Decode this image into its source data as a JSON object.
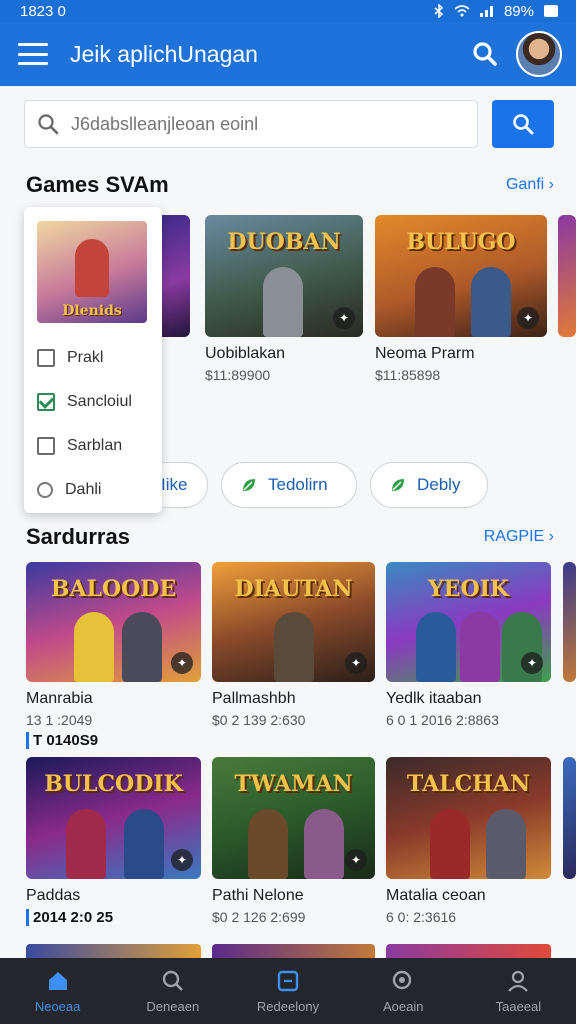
{
  "status_bar": {
    "time": "1823 0",
    "battery": "89%"
  },
  "app_bar": {
    "title": "Jeik aplichUnagan"
  },
  "search": {
    "placeholder": "J6dabslleanjleoan eoinl"
  },
  "section1": {
    "title": "Games SVAm",
    "see_all": "Ganfi",
    "arrow": "›",
    "cards": [
      {
        "tag": "DUOBAN",
        "title": "Uobiblakan",
        "sub": "$11:89900"
      },
      {
        "tag": "BULUGO",
        "title": "Neoma Prarm",
        "sub": "$11:85898"
      }
    ]
  },
  "dropdown": {
    "image_tag": "Dlenids",
    "items": [
      {
        "label": "Prakl",
        "checked": false
      },
      {
        "label": "Sancloiul",
        "checked": true
      },
      {
        "label": "Sarblan",
        "checked": false
      },
      {
        "label": "Dahli"
      }
    ]
  },
  "chips": [
    {
      "label": "Iike"
    },
    {
      "label": "Tedolirn"
    },
    {
      "label": "Debly"
    }
  ],
  "section2": {
    "title": "Sardurras",
    "see_all": "RAGPIE",
    "arrow": "›",
    "cards": [
      {
        "tag": "BALOODE",
        "title": "Manrabia",
        "sub": "13 1 :2049",
        "date": "T 0140S9"
      },
      {
        "tag": "DIAUTAN",
        "title": "Pallmashbh",
        "sub": "$0 2 139 2:630",
        "date": ""
      },
      {
        "tag": "YEOIK",
        "title": "Yedlk itaaban",
        "sub": "6 0 1 2016 2:8863",
        "date": ""
      },
      {
        "tag": "BULCODIK",
        "title": "Paddas",
        "sub": "",
        "date": "2014 2:0 25"
      },
      {
        "tag": "TWAMAN",
        "title": "Pathi Nelone",
        "sub": "$0 2 126 2:699",
        "date": ""
      },
      {
        "tag": "TALCHAN",
        "title": "Matalia ceoan",
        "sub": "6 0: 2:3616",
        "date": ""
      }
    ]
  },
  "bottom_nav": [
    {
      "label": "Neoeaa",
      "icon": "home-icon",
      "active": true
    },
    {
      "label": "Deneaen",
      "icon": "search-icon",
      "active": false
    },
    {
      "label": "Redeelony",
      "icon": "library-icon",
      "active": false
    },
    {
      "label": "Aoeain",
      "icon": "discover-icon",
      "active": false
    },
    {
      "label": "Taaeeal",
      "icon": "profile-icon",
      "active": false
    }
  ],
  "colors": {
    "primary": "#1e72da",
    "nav_bg": "#23262b",
    "active": "#3d8ef7"
  }
}
